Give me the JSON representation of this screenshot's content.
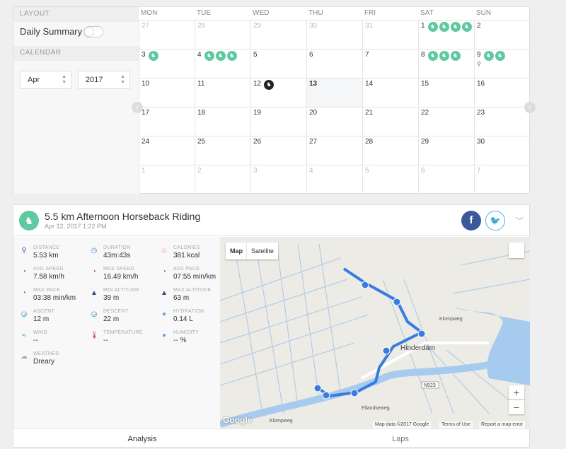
{
  "sidebar": {
    "layout_header": "LAYOUT",
    "daily_summary_label": "Daily Summary",
    "daily_summary_on": false,
    "calendar_header": "CALENDAR",
    "month": "Apr",
    "year": "2017"
  },
  "calendar": {
    "weekdays": [
      "MON",
      "TUE",
      "WED",
      "THU",
      "FRI",
      "SAT",
      "SUN"
    ],
    "weeks": [
      [
        {
          "d": "27",
          "other": true
        },
        {
          "d": "28",
          "other": true
        },
        {
          "d": "29",
          "other": true
        },
        {
          "d": "30",
          "other": true
        },
        {
          "d": "31",
          "other": true
        },
        {
          "d": "1",
          "acts": 4
        },
        {
          "d": "2"
        }
      ],
      [
        {
          "d": "3",
          "acts": 1
        },
        {
          "d": "4",
          "acts": 3
        },
        {
          "d": "5"
        },
        {
          "d": "6"
        },
        {
          "d": "7"
        },
        {
          "d": "8",
          "acts": 3
        },
        {
          "d": "9",
          "acts": 2,
          "pin": true
        }
      ],
      [
        {
          "d": "10"
        },
        {
          "d": "11"
        },
        {
          "d": "12",
          "acts": 1,
          "dark": true
        },
        {
          "d": "13",
          "today": true
        },
        {
          "d": "14"
        },
        {
          "d": "15"
        },
        {
          "d": "16"
        }
      ],
      [
        {
          "d": "17"
        },
        {
          "d": "18"
        },
        {
          "d": "19"
        },
        {
          "d": "20"
        },
        {
          "d": "21"
        },
        {
          "d": "22"
        },
        {
          "d": "23"
        }
      ],
      [
        {
          "d": "24"
        },
        {
          "d": "25"
        },
        {
          "d": "26"
        },
        {
          "d": "27"
        },
        {
          "d": "28"
        },
        {
          "d": "29"
        },
        {
          "d": "30"
        }
      ],
      [
        {
          "d": "1",
          "other": true
        },
        {
          "d": "2",
          "other": true
        },
        {
          "d": "3",
          "other": true
        },
        {
          "d": "4",
          "other": true
        },
        {
          "d": "5",
          "other": true
        },
        {
          "d": "6",
          "other": true
        },
        {
          "d": "7",
          "other": true
        }
      ]
    ]
  },
  "activity": {
    "title": "5.5 km Afternoon Horseback Riding",
    "date": "Apr 12, 2017 1:22 PM",
    "facebook_label": "f",
    "stats": [
      {
        "key": "DISTANCE",
        "value": "5.53 km",
        "icon": "distance-icon",
        "color": "#7a3fa0",
        "glyph": "⚲"
      },
      {
        "key": "DURATION",
        "value": "43m:43s",
        "icon": "stopwatch-icon",
        "color": "#3a8ee6",
        "glyph": "◷"
      },
      {
        "key": "CALORIES",
        "value": "381 kcal",
        "icon": "flame-icon",
        "color": "#e8553a",
        "glyph": "♨"
      },
      {
        "key": "AVG SPEED",
        "value": "7.58 km/h",
        "icon": "speedometer-icon",
        "color": "#d23b3b",
        "glyph": "◔"
      },
      {
        "key": "MAX SPEED",
        "value": "16.49 km/h",
        "icon": "speedometer-icon",
        "color": "#d23b3b",
        "glyph": "◔"
      },
      {
        "key": "AVG PACE",
        "value": "07:55 min/km",
        "icon": "pace-icon",
        "color": "#2a9a6a",
        "glyph": "◔"
      },
      {
        "key": "MAX PACE",
        "value": "03:38 min/km",
        "icon": "pace-icon",
        "color": "#2a9a6a",
        "glyph": "◔"
      },
      {
        "key": "MIN ALTITUDE",
        "value": "39 m",
        "icon": "mountain-icon",
        "color": "#2a4b8d",
        "glyph": "▲"
      },
      {
        "key": "MAX ALTITUDE",
        "value": "63 m",
        "icon": "mountain-icon",
        "color": "#2a4b8d",
        "glyph": "▲"
      },
      {
        "key": "ASCENT",
        "value": "12 m",
        "icon": "ascent-icon",
        "color": "#1f8fb0",
        "glyph": "◶"
      },
      {
        "key": "DESCENT",
        "value": "22 m",
        "icon": "descent-icon",
        "color": "#1f8fb0",
        "glyph": "◶"
      },
      {
        "key": "HYDRATION",
        "value": "0.14 L",
        "icon": "water-drops-icon",
        "color": "#6aa0e6",
        "glyph": "●"
      },
      {
        "key": "WIND",
        "value": "--",
        "icon": "wind-icon",
        "color": "#3aa0d8",
        "glyph": "≈"
      },
      {
        "key": "TEMPERATURE",
        "value": "--",
        "icon": "thermometer-icon",
        "color": "#b03a5a",
        "glyph": "🌡"
      },
      {
        "key": "HUMIDITY",
        "value": "-- %",
        "icon": "humidity-icon",
        "color": "#6aa0e6",
        "glyph": "●"
      },
      {
        "key": "WEATHER",
        "value": "Dreary",
        "icon": "cloud-icon",
        "color": "#aaaaaa",
        "glyph": "☁"
      }
    ],
    "map": {
      "map_button": "Map",
      "satellite_button": "Satellite",
      "place_label": "Hinderdam",
      "road_label": "N523",
      "street_labels": [
        "Klompweg",
        "Hinderdam",
        "Eilandseweg",
        "Klompweg",
        "Hinderdam"
      ],
      "waypoints": [
        "1",
        "2",
        "3",
        "4",
        "5",
        "6"
      ],
      "zoom_in": "+",
      "zoom_out": "−",
      "map_data": "Map data ©2017 Google",
      "terms": "Terms of Use",
      "report": "Report a map error",
      "google": "Google"
    },
    "tabs": [
      "Analysis",
      "Laps"
    ]
  }
}
